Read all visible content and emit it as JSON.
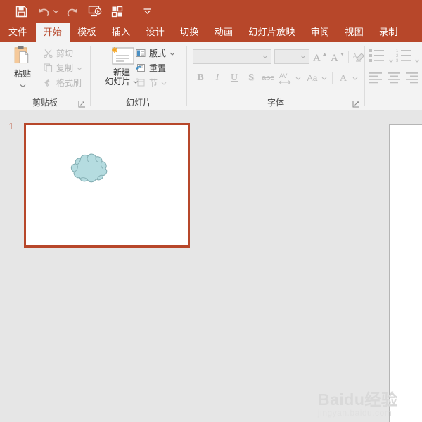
{
  "app": {
    "accent_color": "#b7472a",
    "ribbon_bg": "#f3f3f3",
    "canvas_bg": "#e6e6e6"
  },
  "quick_access": {
    "items": [
      {
        "name": "save-icon",
        "label": "保存"
      },
      {
        "name": "undo-icon",
        "label": "撤消"
      },
      {
        "name": "undo-dropdown-caret",
        "label": "撤消下拉"
      },
      {
        "name": "redo-icon",
        "label": "恢复"
      },
      {
        "name": "start-slideshow-icon",
        "label": "从头开始"
      },
      {
        "name": "customize-layout-icon",
        "label": "自定义"
      },
      {
        "name": "customize-qat-caret",
        "label": "自定义快速访问工具栏"
      }
    ]
  },
  "tabs": [
    {
      "label": "文件",
      "active": false
    },
    {
      "label": "开始",
      "active": true
    },
    {
      "label": "模板",
      "active": false
    },
    {
      "label": "插入",
      "active": false
    },
    {
      "label": "设计",
      "active": false
    },
    {
      "label": "切换",
      "active": false
    },
    {
      "label": "动画",
      "active": false
    },
    {
      "label": "幻灯片放映",
      "active": false
    },
    {
      "label": "审阅",
      "active": false
    },
    {
      "label": "视图",
      "active": false
    },
    {
      "label": "录制",
      "active": false
    }
  ],
  "ribbon": {
    "clipboard": {
      "group_label": "剪贴板",
      "paste": {
        "label": "粘贴"
      },
      "cut": {
        "label": "剪切"
      },
      "copy": {
        "label": "复制"
      },
      "format_painter": {
        "label": "格式刷"
      }
    },
    "slides": {
      "group_label": "幻灯片",
      "new_slide": {
        "label_line1": "新建",
        "label_line2": "幻灯片"
      },
      "layout": {
        "label": "版式"
      },
      "reset": {
        "label": "重置"
      },
      "section": {
        "label": "节"
      }
    },
    "font": {
      "group_label": "字体",
      "font_name": {
        "value": "",
        "placeholder": ""
      },
      "font_size": {
        "value": "",
        "placeholder": ""
      },
      "increase_size": {
        "label": "A"
      },
      "decrease_size": {
        "label": "A"
      },
      "clear_formatting": {
        "label": "清除所有格式"
      },
      "bold": {
        "label": "B"
      },
      "italic": {
        "label": "I"
      },
      "underline": {
        "label": "U"
      },
      "shadow": {
        "label": "S"
      },
      "strikethrough": {
        "label": "abc"
      },
      "character_spacing": {
        "label": "AV"
      },
      "change_case": {
        "label": "Aa"
      },
      "font_color": {
        "label": "A"
      }
    },
    "paragraph": {
      "bullets": {
        "label": "项目符号"
      },
      "numbering": {
        "label": "编号"
      },
      "align_left": {
        "label": "左对齐"
      },
      "align_center": {
        "label": "居中"
      },
      "align_right": {
        "label": "右对齐"
      }
    }
  },
  "slide_pane": {
    "slides": [
      {
        "number": "1",
        "selected": true,
        "shapes": [
          {
            "name": "cloud-shape",
            "type": "cloud",
            "fill": "#b5dce0",
            "stroke": "#7ba7ad"
          }
        ]
      }
    ]
  },
  "watermark": {
    "brand": "Baidu",
    "brand_cn": "经验",
    "url": "jingyan.baidu.com"
  }
}
